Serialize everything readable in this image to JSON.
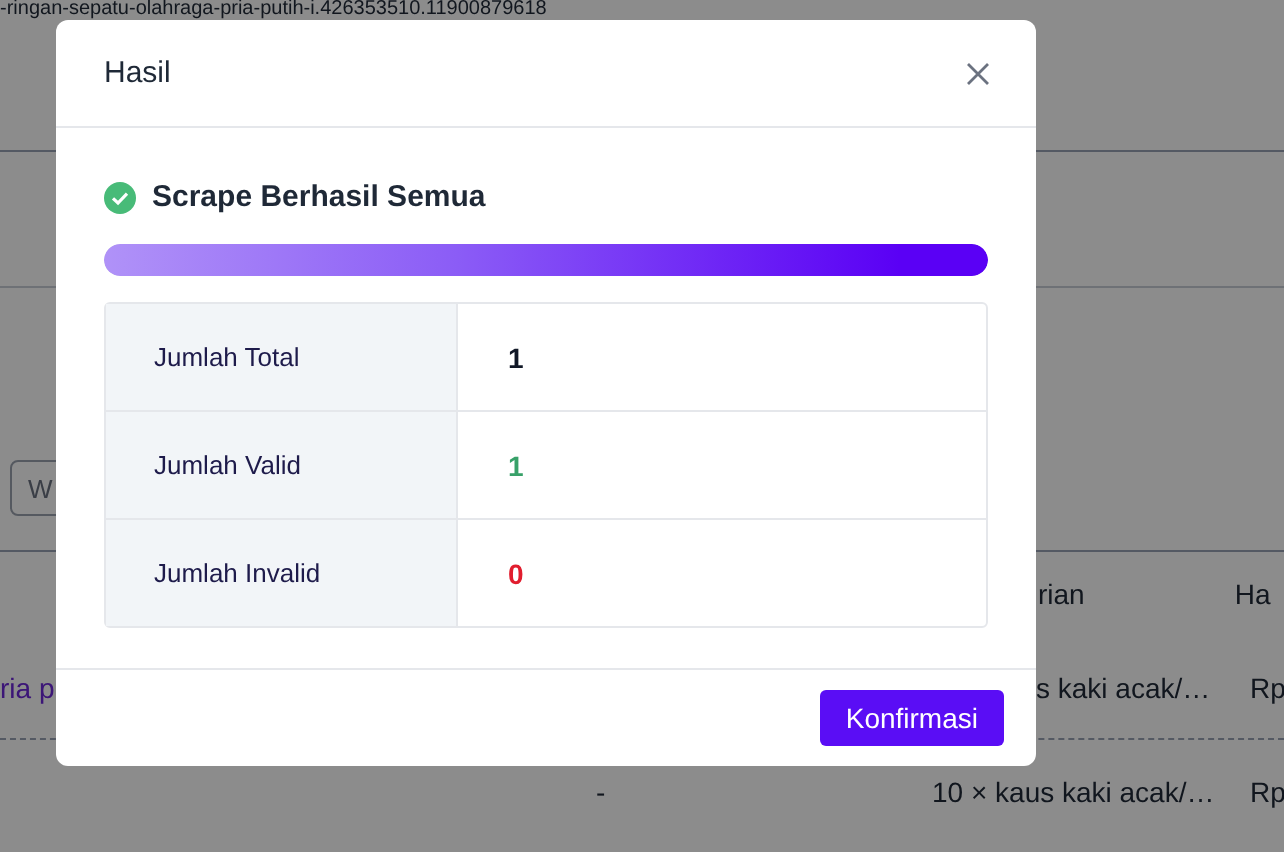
{
  "page": {
    "url_text": "-ringan-sepatu-olahraga-pria-putih-i.426353510.11900879618",
    "filter_field": {
      "placeholder": "W"
    },
    "table": {
      "columns": [
        {
          "label": "rian"
        },
        {
          "label": "Ha"
        }
      ],
      "rows": [
        {
          "column_1": "ria p",
          "column_3": "s kaki acak/…",
          "column_4": "Rp"
        },
        {
          "column_2": "-",
          "column_3": "10 × kaus kaki acak/…",
          "column_4": "Rp"
        }
      ]
    }
  },
  "dialog": {
    "title": "Hasil",
    "status": {
      "kind": "success",
      "text": "Scrape Berhasil Semua"
    },
    "progress": {
      "level": 1
    },
    "stats": [
      {
        "label": "Jumlah Total",
        "value": "1",
        "kind": "total"
      },
      {
        "label": "Jumlah Valid",
        "value": "1",
        "kind": "valid"
      },
      {
        "label": "Jumlah Invalid",
        "value": "0",
        "kind": "invalid"
      }
    ],
    "button": "Konfirmasi"
  }
}
